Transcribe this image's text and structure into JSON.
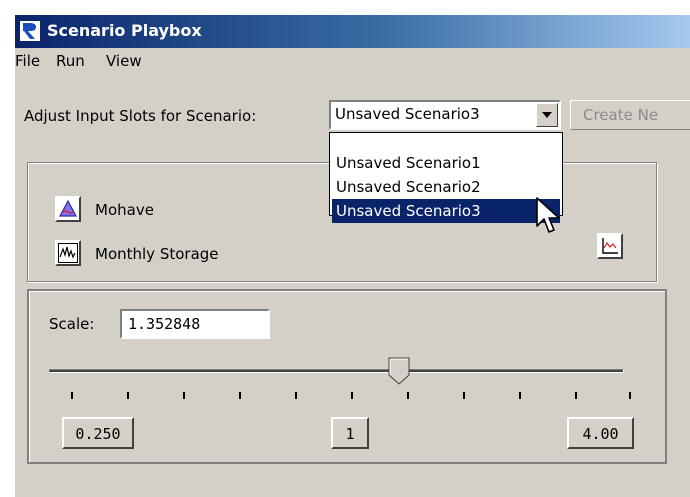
{
  "window": {
    "title": "Scenario Playbox"
  },
  "menu": [
    "File",
    "Run",
    "View"
  ],
  "scenario": {
    "label": "Adjust Input Slots for Scenario:",
    "selected": "Unsaved Scenario3",
    "options": [
      "Unsaved Scenario1",
      "Unsaved Scenario2",
      "Unsaved Scenario3"
    ],
    "highlighted_index": 2,
    "create_label": "Create Ne"
  },
  "object": {
    "name": "Mohave",
    "slot": "Monthly Storage",
    "icon_name": "reservoir-icon",
    "slot_icon_name": "series-slot-icon",
    "plot_icon_name": "plot-icon"
  },
  "scale": {
    "label": "Scale:",
    "value": "1.352848",
    "min_label": "0.250",
    "mid_label": "1",
    "max_label": "4.00",
    "slider_position": 0.61
  },
  "colors": {
    "title_start": "#0a246a",
    "title_end": "#a6caf0",
    "selection": "#0a246a",
    "face": "#d4d0c8"
  }
}
